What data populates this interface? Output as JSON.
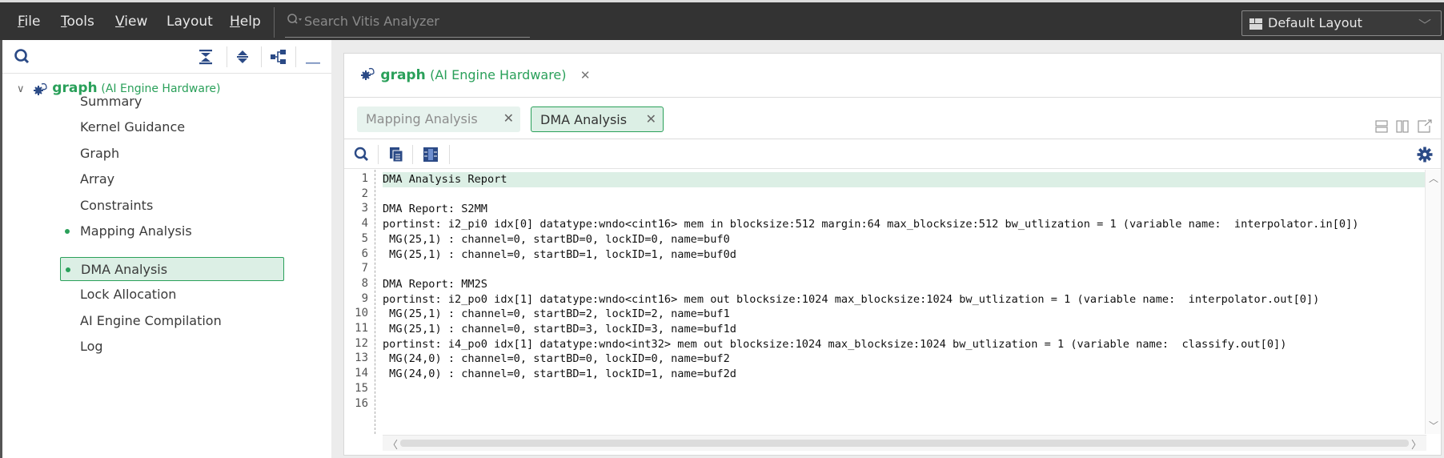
{
  "menubar": {
    "items": [
      {
        "label": "File",
        "mnemonic": "F",
        "rest": "ile"
      },
      {
        "label": "Tools",
        "mnemonic": "T",
        "rest": "ools"
      },
      {
        "label": "View",
        "mnemonic": "V",
        "rest": "iew"
      },
      {
        "label": "Layout",
        "mnemonic": "",
        "rest": "Layout"
      },
      {
        "label": "Help",
        "mnemonic": "H",
        "rest": "elp"
      }
    ],
    "search_placeholder": "Search Vitis Analyzer",
    "layout_select": "Default Layout"
  },
  "left_panel": {
    "toolbar_icons": [
      "search-icon",
      "collapse-all-icon",
      "expand-all-icon",
      "hierarchy-icon",
      "minimize-icon"
    ],
    "root": {
      "name": "graph",
      "type": "(AI Engine Hardware)"
    },
    "items": [
      {
        "label": "Summary",
        "dot": false,
        "selected": false
      },
      {
        "label": "Kernel Guidance",
        "dot": false,
        "selected": false
      },
      {
        "label": "Graph",
        "dot": false,
        "selected": false
      },
      {
        "label": "Array",
        "dot": false,
        "selected": false
      },
      {
        "label": "Constraints",
        "dot": false,
        "selected": false
      },
      {
        "label": "Mapping Analysis",
        "dot": true,
        "selected": false
      },
      {
        "label": "DMA Analysis",
        "dot": true,
        "selected": true
      },
      {
        "label": "Lock Allocation",
        "dot": false,
        "selected": false
      },
      {
        "label": "AI Engine Compilation",
        "dot": false,
        "selected": false
      },
      {
        "label": "Log",
        "dot": false,
        "selected": false
      }
    ]
  },
  "document": {
    "title": {
      "name": "graph",
      "type": "(AI Engine Hardware)"
    },
    "subtabs": [
      {
        "label": "Mapping Analysis",
        "active": false
      },
      {
        "label": "DMA Analysis",
        "active": true
      }
    ],
    "close_glyph": "✕"
  },
  "editor": {
    "highlighted_line": 1,
    "lines": [
      "DMA Analysis Report",
      "",
      "DMA Report: S2MM",
      "portinst: i2_pi0 idx[0] datatype:wndo<cint16> mem in blocksize:512 margin:64 max_blocksize:512 bw_utlization = 1 (variable name:  interpolator.in[0])",
      " MG(25,1) : channel=0, startBD=0, lockID=0, name=buf0",
      " MG(25,1) : channel=0, startBD=1, lockID=1, name=buf0d",
      "",
      "DMA Report: MM2S",
      "portinst: i2_po0 idx[1] datatype:wndo<cint16> mem out blocksize:1024 max_blocksize:1024 bw_utlization = 1 (variable name:  interpolator.out[0])",
      " MG(25,1) : channel=0, startBD=2, lockID=2, name=buf1",
      " MG(25,1) : channel=0, startBD=3, lockID=3, name=buf1d",
      "portinst: i4_po0 idx[1] datatype:wndo<int32> mem out blocksize:1024 max_blocksize:1024 bw_utlization = 1 (variable name:  classify.out[0])",
      " MG(24,0) : channel=0, startBD=0, lockID=0, name=buf2",
      " MG(24,0) : channel=0, startBD=1, lockID=1, name=buf2d",
      "",
      ""
    ]
  },
  "colors": {
    "accent": "#2aa05a",
    "selection_bg": "#dcefe5",
    "icon_blue": "#2b4a86",
    "menubar_bg": "#333333"
  }
}
